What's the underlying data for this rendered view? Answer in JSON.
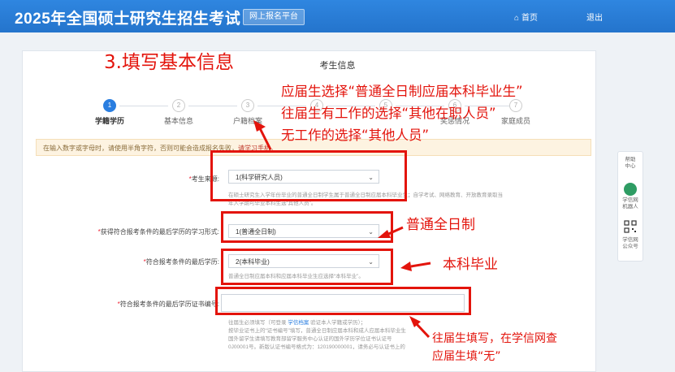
{
  "header": {
    "title": "2025年全国硕士研究生招生考试",
    "platform": "网上报名平台",
    "home": "首页",
    "logout": "退出"
  },
  "page": {
    "heading": "考生信息"
  },
  "steps": [
    {
      "num": "1",
      "label": "学籍学历",
      "active": true
    },
    {
      "num": "2",
      "label": "基本信息",
      "active": false
    },
    {
      "num": "3",
      "label": "户籍档案",
      "active": false
    },
    {
      "num": "4",
      "label": "",
      "active": false
    },
    {
      "num": "5",
      "label": "",
      "active": false
    },
    {
      "num": "6",
      "label": "奖惩情况",
      "active": false
    },
    {
      "num": "7",
      "label": "家庭成员",
      "active": false
    }
  ],
  "notice": {
    "text": "在输入数字或字母时，请使用半角字符，否则可能会造成报名失败，",
    "highlight": "请学习手机。"
  },
  "form": {
    "candidate_source": {
      "label": "考生来源:",
      "value": "1(科学研究人员)",
      "help1": "在硕士研究生入学年份毕业的普通全日制学生属于普通全日制应届本科毕业生；自学考试、网络教育、开放教育录取当",
      "help2": "年入学期可毕业本科生选“其他人员”。"
    },
    "study_form": {
      "label": "获得符合报考条件的最后学历的学习形式:",
      "value": "1(普通全日制)"
    },
    "last_degree": {
      "label": "符合报考条件的最后学历:",
      "value": "2(本科毕业)",
      "help": "普通全日制应届本科和应届本科毕业生应选择“本科毕业”。"
    },
    "cert_number": {
      "label": "符合报考条件的最后学历证书编号:",
      "value": "",
      "help1_pre": "往届生必须填写（可登录 ",
      "help1_link": "学信档案",
      "help1_post": " 验证本人学籍或学历）；",
      "help2": "按毕业证书上的“证书编号”填写，普通全日制应届本科和成人应届本科毕业生",
      "help3": "国外留学生请填写教育部留学服务中心认证的国外学历学位证书认证号",
      "help4": "0J00001号。新版认证书编号格式为：120190000001，请务必与认证书上的"
    }
  },
  "annotations": {
    "step_title": "3.填写基本信息",
    "source_line1": "应届生选择“普通全日制应届本科毕业生”",
    "source_line2": "往届生有工作的选择“其他在职人员”",
    "source_line3": "无工作的选择“其他人员”",
    "study_form_note": "普通全日制",
    "degree_note": "本科毕业",
    "cert_note_line1": "往届生填写，在学信网查",
    "cert_note_line2": "应届生填“无”",
    "color": "#e3140c"
  },
  "side_panel": {
    "help": "帮助中心",
    "robot": "学信网机器人",
    "qr": "学信网公众号"
  }
}
